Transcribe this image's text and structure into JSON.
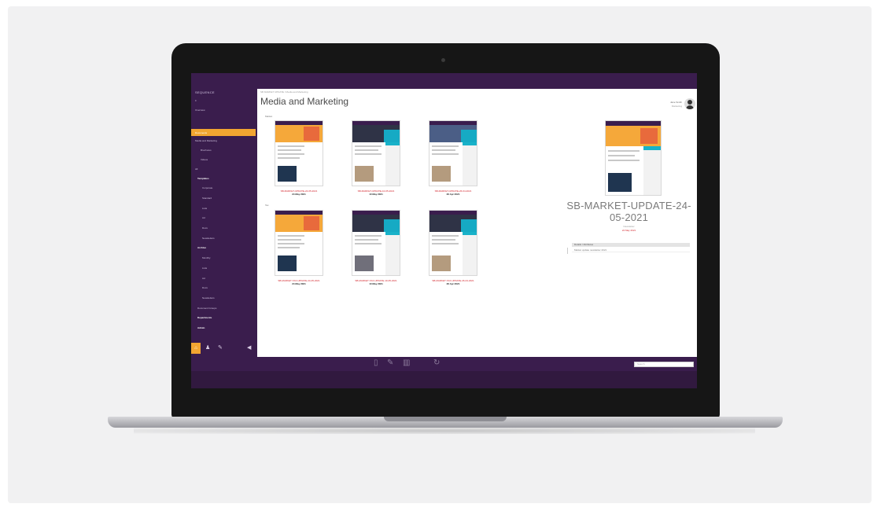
{
  "app": {
    "logo": "SEQUENCE",
    "breadcrumb": "SB MARKET UPDATE / Media and Marketing",
    "page_title": "Media and Marketing",
    "user": {
      "name": "Jane Smith",
      "role": "Marketing"
    }
  },
  "sidebar": {
    "items": [
      {
        "label": "≡",
        "style": "normal"
      },
      {
        "label": "Overview",
        "style": "normal"
      },
      {
        "label": "Documents",
        "style": "active"
      },
      {
        "label": "Media and Marketing",
        "style": "normal"
      },
      {
        "label": "Brochures",
        "style": "normal"
      },
      {
        "label": "Videos",
        "style": "normal"
      },
      {
        "label": "All",
        "style": "normal"
      },
      {
        "label": "Templates",
        "style": "bold"
      },
      {
        "label": "Corporate",
        "style": "normal"
      },
      {
        "label": "Standard",
        "style": "normal"
      },
      {
        "label": "Lists",
        "style": "normal"
      },
      {
        "label": "Ad",
        "style": "normal"
      },
      {
        "label": "Docs",
        "style": "normal"
      },
      {
        "label": "Newsletters",
        "style": "normal"
      },
      {
        "label": "Archive",
        "style": "bold"
      },
      {
        "label": "Monthly",
        "style": "normal"
      },
      {
        "label": "Lists",
        "style": "normal"
      },
      {
        "label": "Ad",
        "style": "normal"
      },
      {
        "label": "Docs",
        "style": "normal"
      },
      {
        "label": "Newsletters",
        "style": "normal"
      },
      {
        "label": "Document Groups",
        "style": "normal"
      },
      {
        "label": "Departments",
        "style": "bold"
      },
      {
        "label": "Admin",
        "style": "bold"
      }
    ]
  },
  "sections": {
    "first": "Market",
    "second": "Tax"
  },
  "documents": [
    {
      "title": "SB-MARKET-UPDATE-24-05-2021",
      "date": "24 May 2021",
      "hero": "orange"
    },
    {
      "title": "SB-MARKET-UPDATE-10-05-2021",
      "date": "10 May 2021",
      "hero": "dark"
    },
    {
      "title": "SB-MARKET-UPDATE-26-04-2021",
      "date": "26 Apr 2021",
      "hero": "blue"
    },
    {
      "title": "SB-MARKET-TAX-UPDATE-24-05-2021",
      "date": "24 May 2021",
      "hero": "orange"
    },
    {
      "title": "SB-MARKET-TAX-UPDATE-10-05-2021",
      "date": "10 May 2021",
      "hero": "dark"
    },
    {
      "title": "SB-MARKET-TAX-UPDATE-26-04-2021",
      "date": "26 Apr 2021",
      "hero": "dark"
    }
  ],
  "detail": {
    "title": "SB-MARKET-UPDATE-24-05-2021",
    "subtitle": "Newsletter",
    "tag": "24 May 2021",
    "table_header": "Details / Attributes",
    "table_row": "Market update newsletter 2021"
  },
  "bottombar": {
    "icons": [
      "file-icon",
      "edit-icon",
      "trash-icon",
      "refresh-icon"
    ],
    "search_placeholder": "Search"
  },
  "colors": {
    "brand_purple": "#3a1d4d",
    "accent_orange": "#f2a531",
    "link_red": "#d2232a",
    "accent_cyan": "#19b2c9"
  }
}
